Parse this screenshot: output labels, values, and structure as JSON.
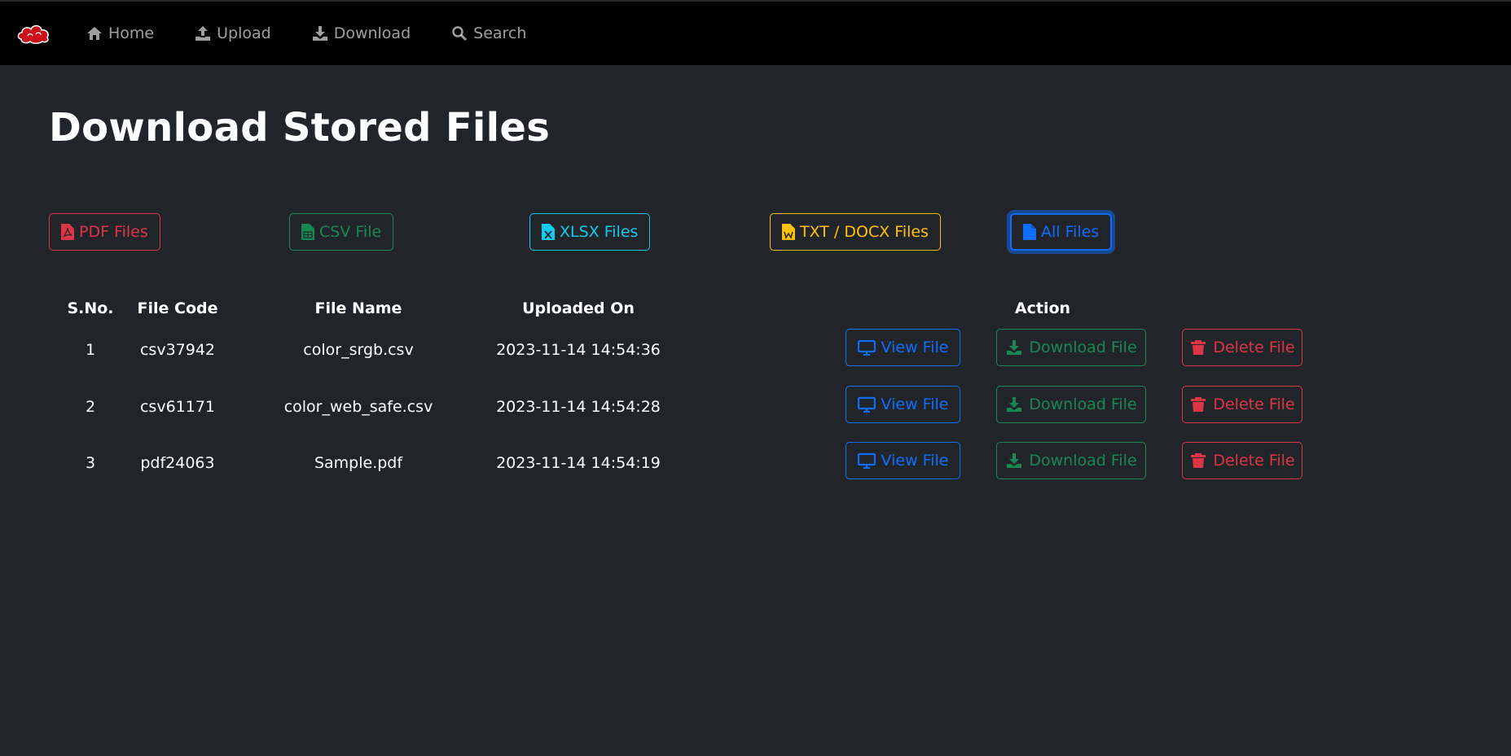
{
  "nav": {
    "items": [
      {
        "label": "Home",
        "icon": "home-icon"
      },
      {
        "label": "Upload",
        "icon": "upload-icon"
      },
      {
        "label": "Download",
        "icon": "download-icon"
      },
      {
        "label": "Search",
        "icon": "search-icon"
      }
    ]
  },
  "page": {
    "title": "Download Stored Files"
  },
  "filters": [
    {
      "label": "PDF Files",
      "icon": "file-pdf-icon",
      "color": "#dc3545"
    },
    {
      "label": "CSV File",
      "icon": "file-csv-icon",
      "color": "#198754"
    },
    {
      "label": "XLSX Files",
      "icon": "file-excel-icon",
      "color": "#0dcaf0"
    },
    {
      "label": "TXT / DOCX Files",
      "icon": "file-word-icon",
      "color": "#ffc107"
    },
    {
      "label": "All Files",
      "icon": "file-icon",
      "color": "#0d6efd",
      "active": true
    }
  ],
  "table": {
    "headers": {
      "sno": "S.No.",
      "code": "File Code",
      "name": "File Name",
      "uploaded": "Uploaded On",
      "action": "Action"
    },
    "rows": [
      {
        "sno": "1",
        "code": "csv37942",
        "name": "color_srgb.csv",
        "uploaded": "2023-11-14 14:54:36"
      },
      {
        "sno": "2",
        "code": "csv61171",
        "name": "color_web_safe.csv",
        "uploaded": "2023-11-14 14:54:28"
      },
      {
        "sno": "3",
        "code": "pdf24063",
        "name": "Sample.pdf",
        "uploaded": "2023-11-14 14:54:19"
      }
    ],
    "actions": {
      "view": "View File",
      "download": "Download File",
      "delete": "Delete File"
    }
  }
}
